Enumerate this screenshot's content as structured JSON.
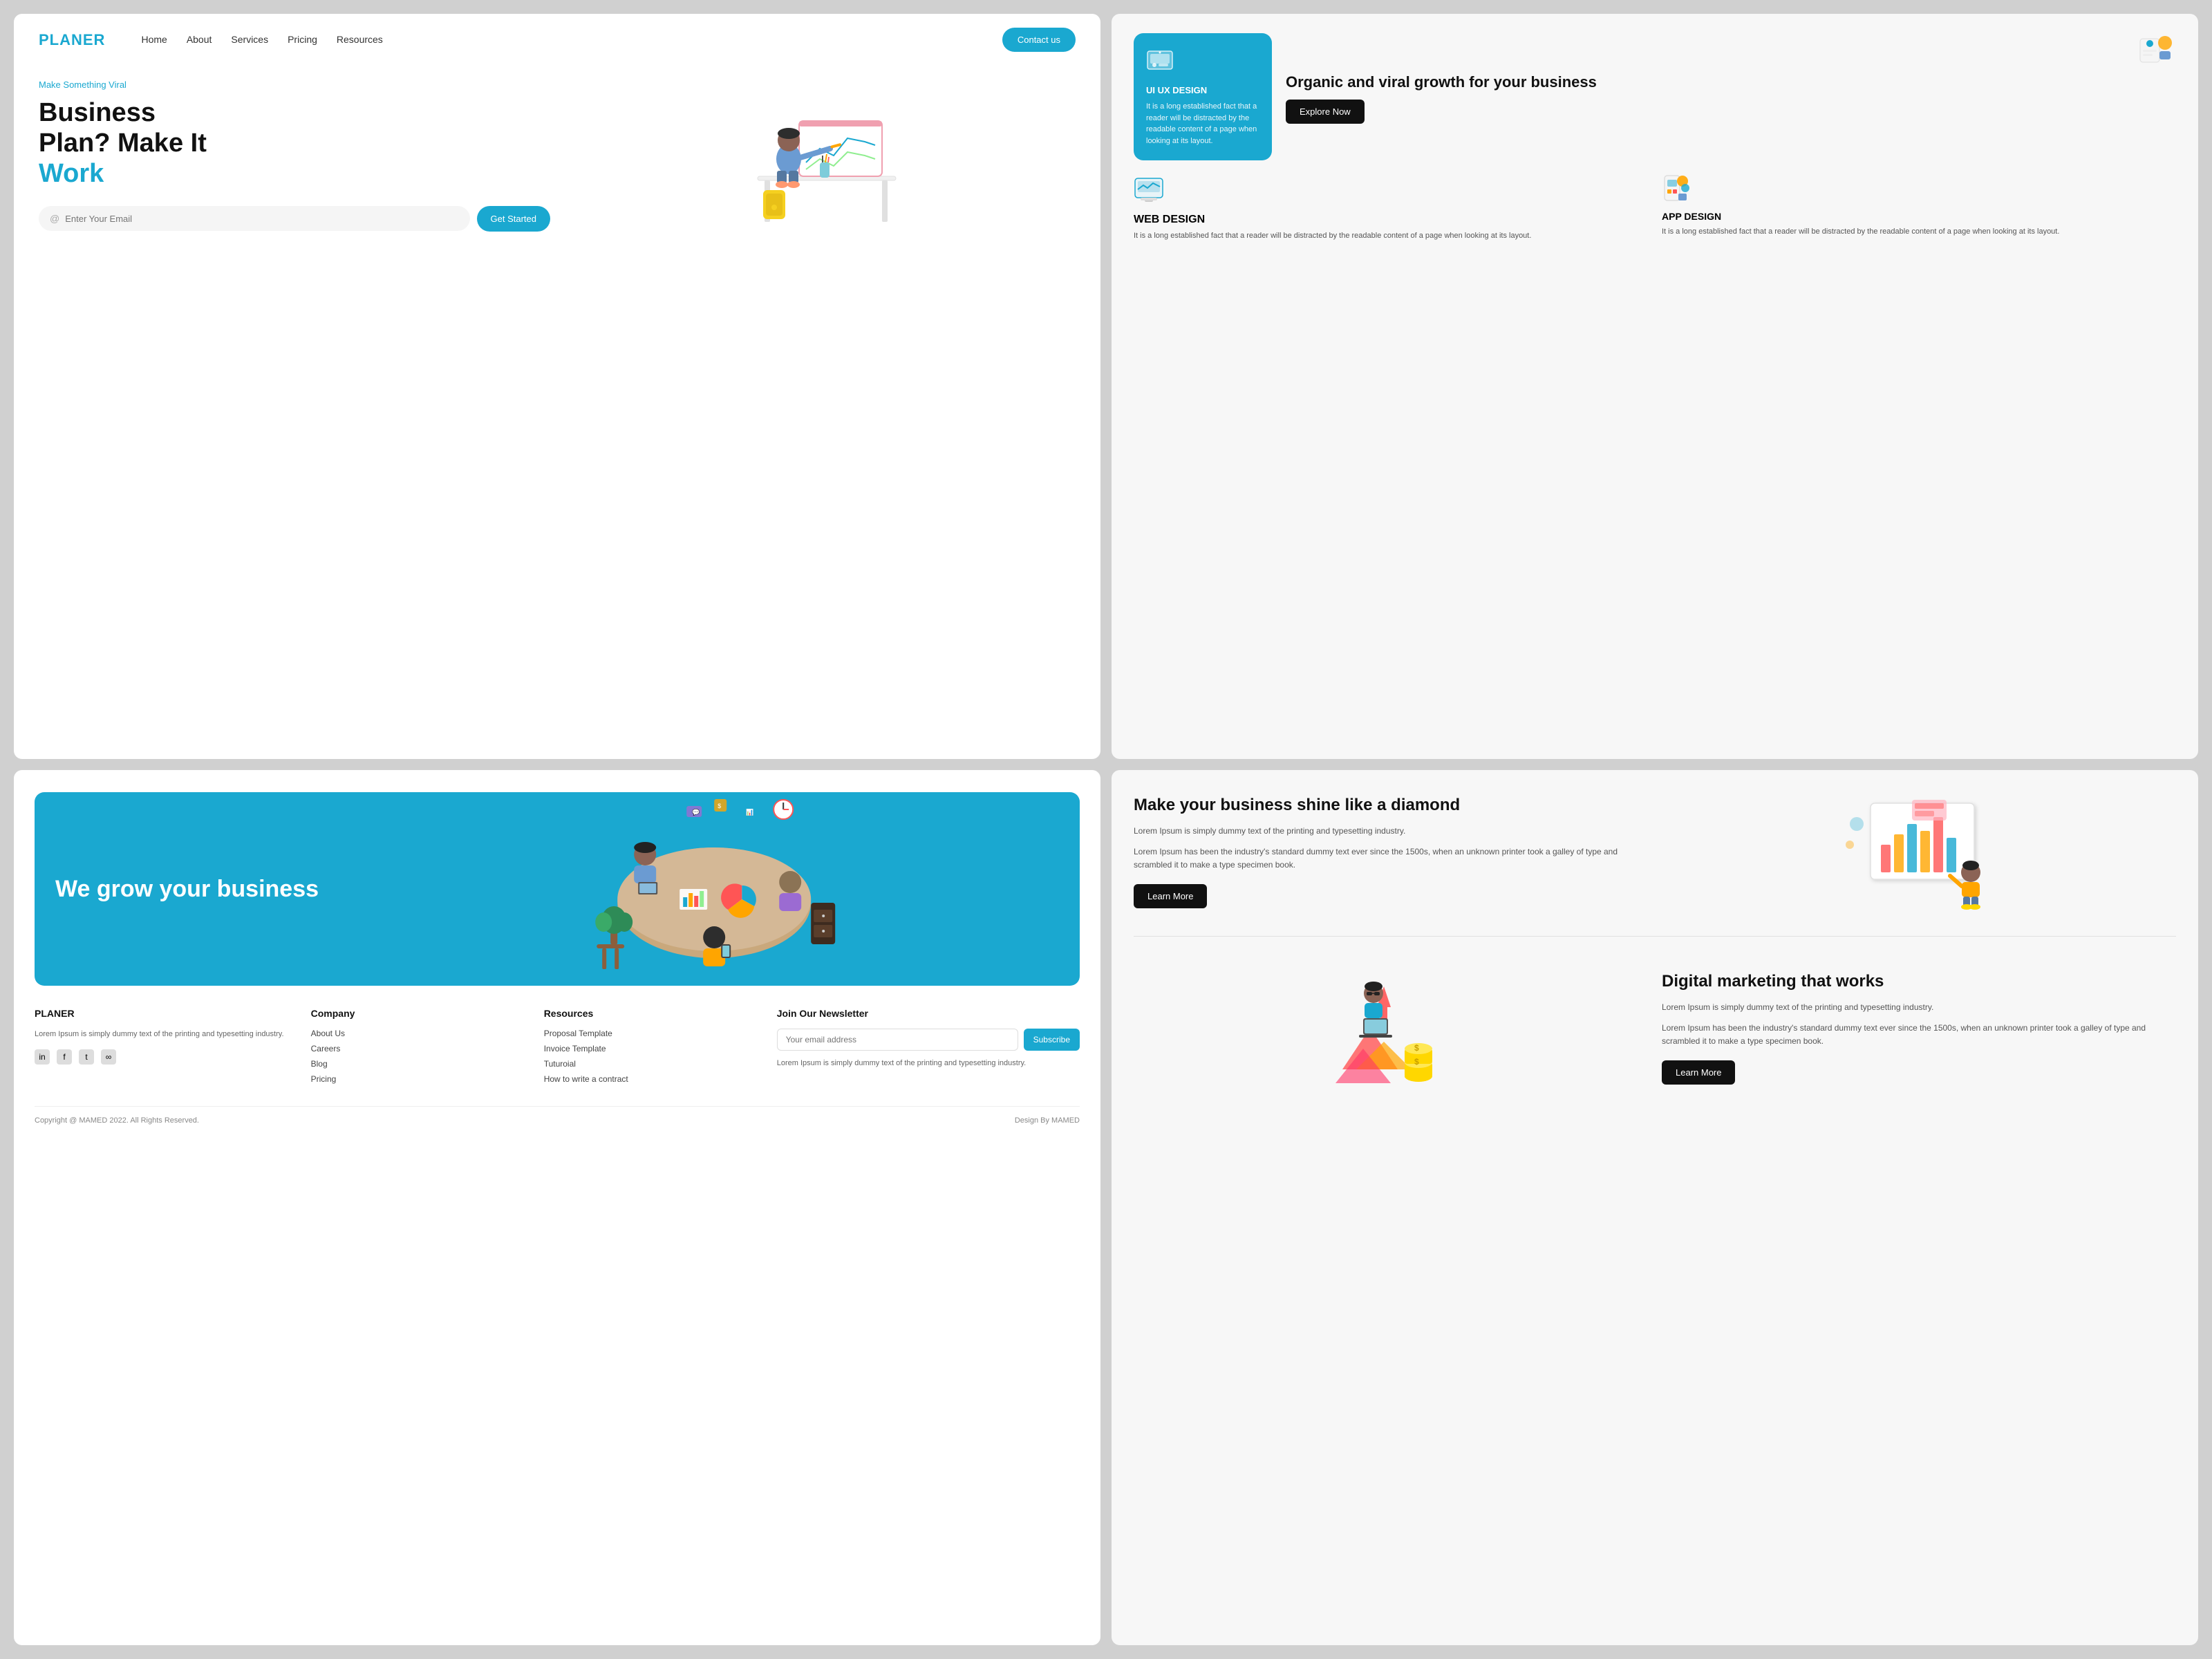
{
  "brand": {
    "logo": "PLANER",
    "accent_color": "#1aa8d0"
  },
  "navbar": {
    "links": [
      {
        "label": "Home",
        "href": "#"
      },
      {
        "label": "About",
        "href": "#"
      },
      {
        "label": "Services",
        "href": "#"
      },
      {
        "label": "Pricing",
        "href": "#"
      },
      {
        "label": "Resources",
        "href": "#"
      }
    ],
    "contact_btn": "Contact us"
  },
  "hero": {
    "tagline": "Make Something Viral",
    "title_line1": "Business",
    "title_line2": "Plan? Make It",
    "title_highlight": "Work",
    "email_placeholder": "Enter Your Email",
    "cta_btn": "Get Started"
  },
  "services": {
    "organic_title": "Organic and viral growth for your business",
    "explore_btn": "Explore Now",
    "ui_ux": {
      "label": "UI UX DESIGN",
      "desc": "It is a long established fact that a reader will be distracted by the readable content of a page when looking at its layout."
    },
    "web_design": {
      "label": "WEB DESIGN",
      "desc": "It is a long established fact that a reader will be distracted by the readable content of a page when looking at its layout."
    },
    "app_design": {
      "label": "APP DESIGN",
      "desc": "It is a long established fact that a reader will be distracted by the readable content of a page when looking at its layout."
    }
  },
  "grow_section": {
    "title": "We grow your business"
  },
  "shine_section": {
    "title": "Make your business shine like a diamond",
    "para1": "Lorem Ipsum is simply dummy text of the printing and typesetting industry.",
    "para2": "Lorem Ipsum has been the industry's standard dummy text ever since the 1500s, when an unknown printer took a galley of type and scrambled it to make a type specimen book.",
    "btn": "Learn More"
  },
  "digital_section": {
    "title": "Digital marketing that works",
    "para1": "Lorem Ipsum is simply dummy text of the printing and typesetting industry.",
    "para2": "Lorem Ipsum has been the industry's standard dummy text ever since the 1500s, when an unknown printer took a galley of type and scrambled it to make a type specimen book.",
    "btn": "Learn More"
  },
  "footer": {
    "brand_name": "PLANER",
    "brand_desc": "Lorem Ipsum is simply dummy text of the printing and typesetting industry.",
    "company_heading": "Company",
    "company_links": [
      "About Us",
      "Careers",
      "Blog",
      "Pricing"
    ],
    "resources_heading": "Resources",
    "resources_links": [
      "Proposal Template",
      "Invoice Template",
      "Tuturoial",
      "How to write a contract"
    ],
    "newsletter_heading": "Join Our Newsletter",
    "newsletter_placeholder": "Your email address",
    "subscribe_btn": "Subscribe",
    "newsletter_desc": "Lorem Ipsum is simply dummy text of the printing and typesetting industry.",
    "copyright": "Copyright @ MAMED 2022. All Rights Reserved.",
    "design_credit": "Design By MAMED"
  }
}
